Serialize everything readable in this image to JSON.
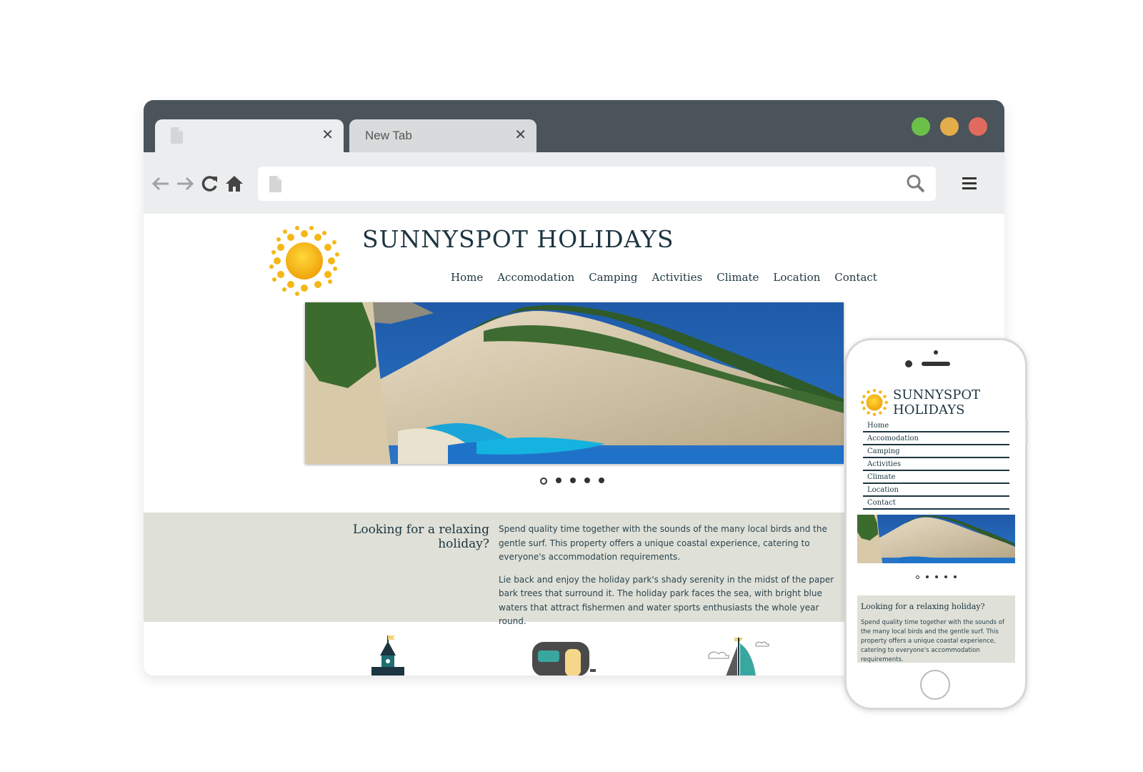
{
  "browser": {
    "tabs": [
      {
        "title": "",
        "close": "✕"
      },
      {
        "title": "New Tab",
        "close": "✕"
      }
    ]
  },
  "site": {
    "title": "SUNNYSPOT HOLIDAYS",
    "nav": [
      "Home",
      "Accomodation",
      "Camping",
      "Activities",
      "Climate",
      "Location",
      "Contact"
    ],
    "intro": {
      "heading": "Looking for a relaxing holiday?",
      "paragraph1": "Spend quality time together with the sounds of the many local birds and the gentle surf. This property offers a unique coastal experience, catering to everyone's accommodation requirements.",
      "paragraph2": "Lie back and enjoy the holiday park's shady serenity in the midst of the paper bark trees that surround it. The holiday park faces the sea, with bright blue waters that attract fishermen and water sports enthusiasts the whole year round."
    },
    "slider_dots": 5,
    "active_dot": 0
  },
  "mobile": {
    "title_line1": "SUNNYSPOT",
    "title_line2": "HOLIDAYS",
    "intro_text": "Spend quality time together with the sounds of the many local birds and the gentle surf. This property offers a unique coastal experience, catering to everyone's accommodation requirements."
  },
  "colors": {
    "titlebar": "#4a545a",
    "toolbar": "#ecedee",
    "site_text": "#1c3540",
    "band": "#dfe0d7",
    "traffic_green": "#6cc04a",
    "traffic_yellow": "#e3ad4a",
    "traffic_red": "#e06b5e"
  }
}
